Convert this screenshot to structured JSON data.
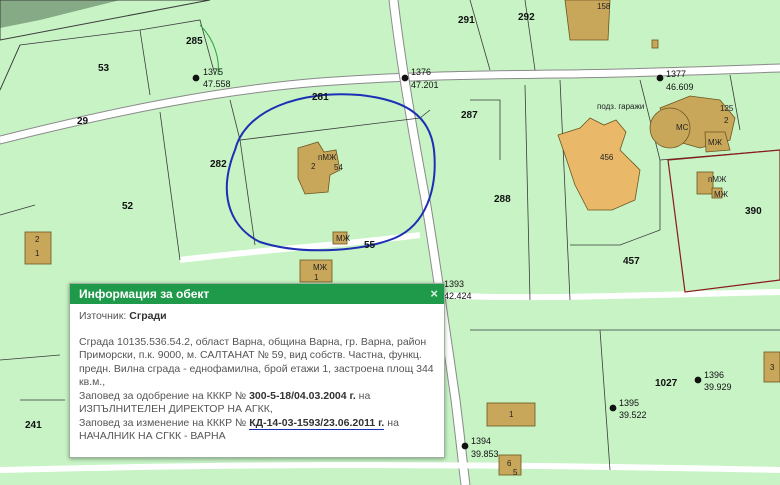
{
  "map": {
    "parcels": [
      "285",
      "53",
      "29",
      "281",
      "282",
      "52",
      "55",
      "287",
      "288",
      "291",
      "292",
      "457",
      "390",
      "1027",
      "241"
    ],
    "points": [
      {
        "id": "1375",
        "value": "47.558"
      },
      {
        "id": "1376",
        "value": "47.201"
      },
      {
        "id": "1377",
        "value": "46.609"
      },
      {
        "id": "1393",
        "value": "42.424"
      },
      {
        "id": "1395",
        "value": "39.522"
      },
      {
        "id": "1396",
        "value": "39.929"
      },
      {
        "id": "1394",
        "value": "39.853"
      }
    ],
    "building_labels": {
      "pmzh": "пМЖ",
      "n2": "2",
      "n54": "54",
      "mzh": "МЖ",
      "n1": "1",
      "n158": "158",
      "garage": "подз. гаражи",
      "n456": "456",
      "ms": "МС",
      "n125": "125",
      "pmzh2": "пМЖ",
      "mzh2": "МЖ",
      "n3": "3",
      "n6": "6",
      "n5": "5"
    },
    "colors": {
      "background": "#c7f3c5",
      "building": "#c9a75a",
      "selected_building": "#e9b868",
      "circle": "#1d2fb5",
      "header": "#1f9a4b"
    }
  },
  "popup": {
    "title": "Информация за обект",
    "close_icon": "×",
    "source_label": "Източник: ",
    "source_value": "Сгради",
    "description": "Сграда 10135.536.54.2, област Варна, община Варна, гр. Варна, район Приморски, п.к. 9000, м. САЛТАНАТ № 59, вид собств. Частна, функц. предн. Вилна сграда - еднофамилна, брой етажи 1, застроена площ 344 кв.м.,",
    "order1_prefix": "Заповед за одобрение на КККР № ",
    "order1_number": "300-5-18/04.03.2004 г.",
    "order1_suffix": " на",
    "order1_by": "ИЗПЪЛНИТЕЛЕН ДИРЕКТОР НА АГКК,",
    "order2_prefix": "Заповед за изменение на КККР № ",
    "order2_number": "КД-14-03-1593/23.06.2011 г.",
    "order2_suffix": " на",
    "order2_by": "НАЧАЛНИК НА СГКК - ВАРНА"
  }
}
